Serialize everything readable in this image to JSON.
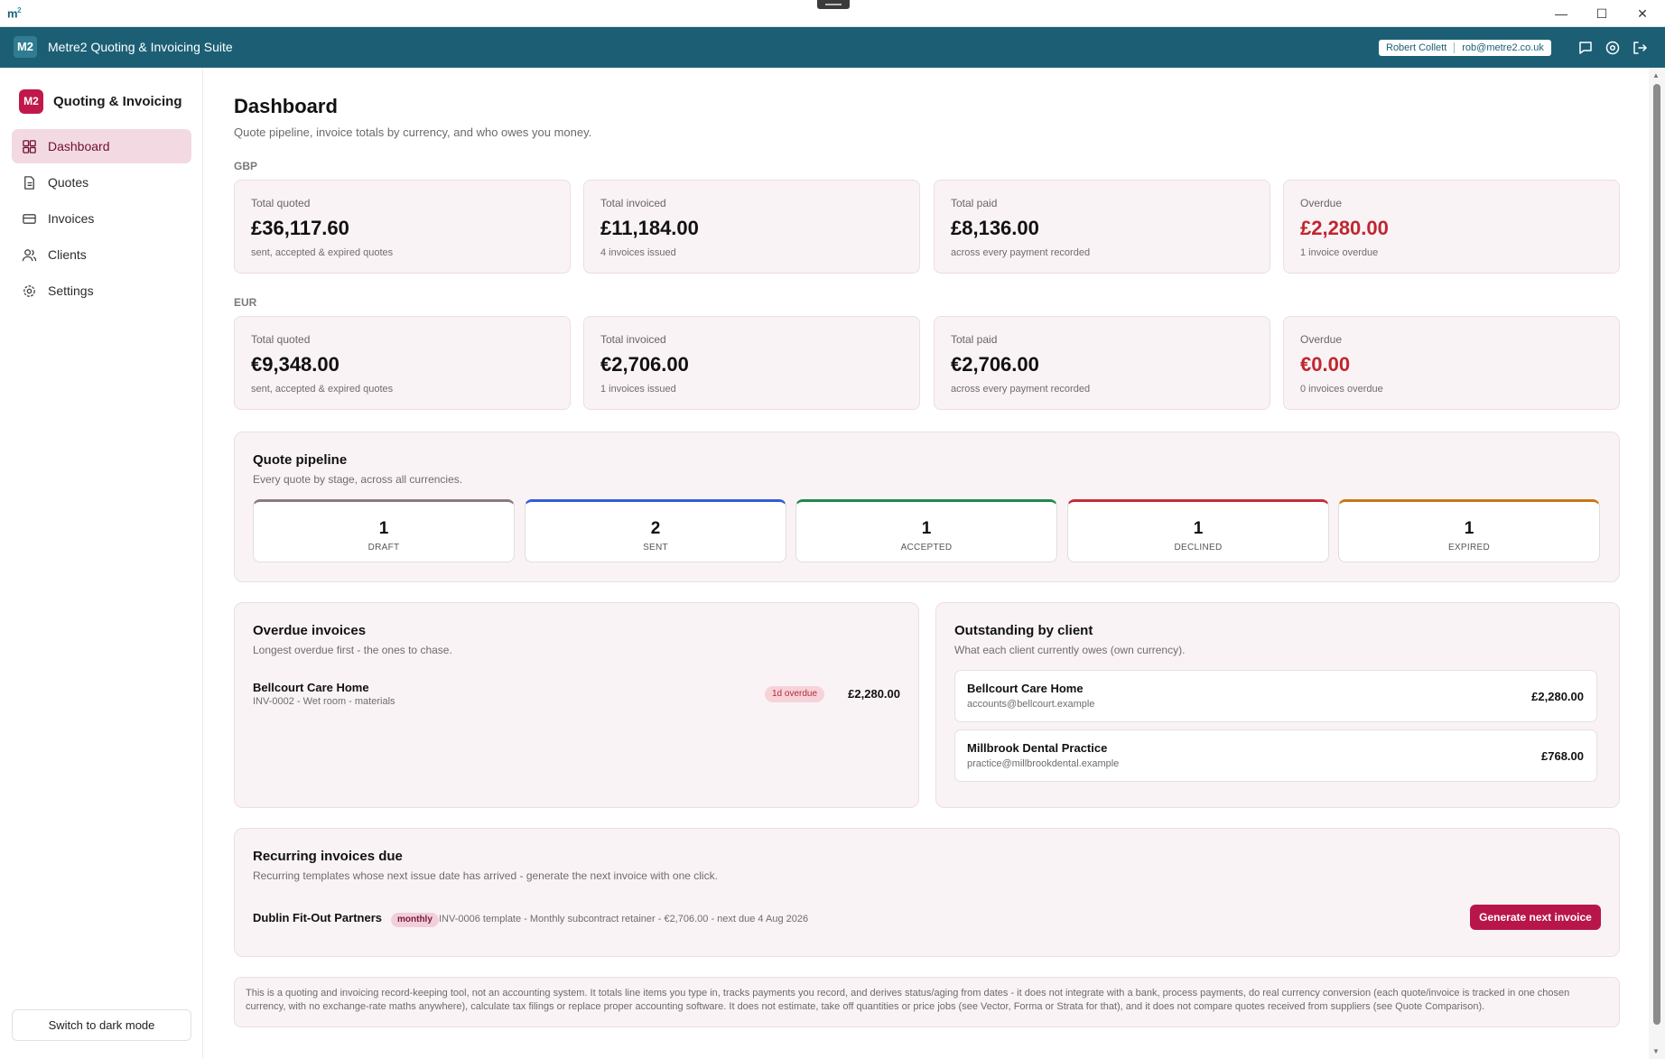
{
  "os": {
    "logo": "m",
    "logo_sup": "2",
    "minimize": "—",
    "maximize": "☐",
    "close": "✕"
  },
  "app": {
    "badge": "M2",
    "title": "Metre2 Quoting & Invoicing Suite",
    "user_name": "Robert Collett",
    "user_email": "rob@metre2.co.uk",
    "header_icons": [
      "chat-icon",
      "settings-icon",
      "logout-icon"
    ]
  },
  "sidebar": {
    "brand_badge": "M2",
    "brand_name": "Quoting & Invoicing",
    "items": [
      {
        "label": "Dashboard",
        "icon": "dashboard-icon",
        "active": true
      },
      {
        "label": "Quotes",
        "icon": "document-icon",
        "active": false
      },
      {
        "label": "Invoices",
        "icon": "card-icon",
        "active": false
      },
      {
        "label": "Clients",
        "icon": "users-icon",
        "active": false
      },
      {
        "label": "Settings",
        "icon": "gear-icon",
        "active": false
      }
    ],
    "dark_mode_button": "Switch to dark mode"
  },
  "page": {
    "title": "Dashboard",
    "subtitle": "Quote pipeline, invoice totals by currency, and who owes you money."
  },
  "currencies": [
    {
      "code": "GBP",
      "stats": [
        {
          "label": "Total quoted",
          "value": "£36,117.60",
          "note": "sent, accepted & expired quotes"
        },
        {
          "label": "Total invoiced",
          "value": "£11,184.00",
          "note": "4 invoices issued"
        },
        {
          "label": "Total paid",
          "value": "£8,136.00",
          "note": "across every payment recorded"
        },
        {
          "label": "Overdue",
          "value": "£2,280.00",
          "note": "1 invoice overdue"
        }
      ]
    },
    {
      "code": "EUR",
      "stats": [
        {
          "label": "Total quoted",
          "value": "€9,348.00",
          "note": "sent, accepted & expired quotes"
        },
        {
          "label": "Total invoiced",
          "value": "€2,706.00",
          "note": "1 invoices issued"
        },
        {
          "label": "Total paid",
          "value": "€2,706.00",
          "note": "across every payment recorded"
        },
        {
          "label": "Overdue",
          "value": "€0.00",
          "note": "0 invoices overdue"
        }
      ]
    }
  ],
  "pipeline": {
    "title": "Quote pipeline",
    "subtitle": "Every quote by stage, across all currencies.",
    "stages": [
      {
        "count": "1",
        "name": "DRAFT",
        "color": "#8a7a80"
      },
      {
        "count": "2",
        "name": "SENT",
        "color": "#2f5fd6"
      },
      {
        "count": "1",
        "name": "ACCEPTED",
        "color": "#218a4a"
      },
      {
        "count": "1",
        "name": "DECLINED",
        "color": "#c62b36"
      },
      {
        "count": "1",
        "name": "EXPIRED",
        "color": "#c9770f"
      }
    ]
  },
  "overdue": {
    "title": "Overdue invoices",
    "subtitle": "Longest overdue first - the ones to chase.",
    "items": [
      {
        "client": "Bellcourt Care Home",
        "detail": "INV-0002 - Wet room - materials",
        "badge": "1d overdue",
        "amount": "£2,280.00"
      }
    ]
  },
  "outstanding": {
    "title": "Outstanding by client",
    "subtitle": "What each client currently owes (own currency).",
    "items": [
      {
        "name": "Bellcourt Care Home",
        "email": "accounts@bellcourt.example",
        "amount": "£2,280.00"
      },
      {
        "name": "Millbrook Dental Practice",
        "email": "practice@millbrookdental.example",
        "amount": "£768.00"
      }
    ]
  },
  "recurring": {
    "title": "Recurring invoices due",
    "subtitle": "Recurring templates whose next issue date has arrived - generate the next invoice with one click.",
    "items": [
      {
        "client": "Dublin Fit-Out Partners",
        "badge": "monthly",
        "detail": "INV-0006 template - Monthly subcontract retainer - €2,706.00 - next due 4 Aug 2026",
        "button": "Generate next invoice"
      }
    ]
  },
  "disclaimer": "This is a quoting and invoicing record-keeping tool, not an accounting system. It totals line items you type in, tracks payments you record, and derives status/aging from dates - it does not integrate with a bank, process payments, do real currency conversion (each quote/invoice is tracked in one chosen currency, with no exchange-rate maths anywhere), calculate tax filings or replace proper accounting software. It does not estimate, take off quantities or price jobs (see Vector, Forma or Strata for that), and it does not compare quotes received from suppliers (see Quote Comparison).",
  "colors": {
    "header": "#1c5f75",
    "accent": "#b8164a",
    "overdue_red": "#c0262f",
    "card_bg": "#faf3f5"
  }
}
